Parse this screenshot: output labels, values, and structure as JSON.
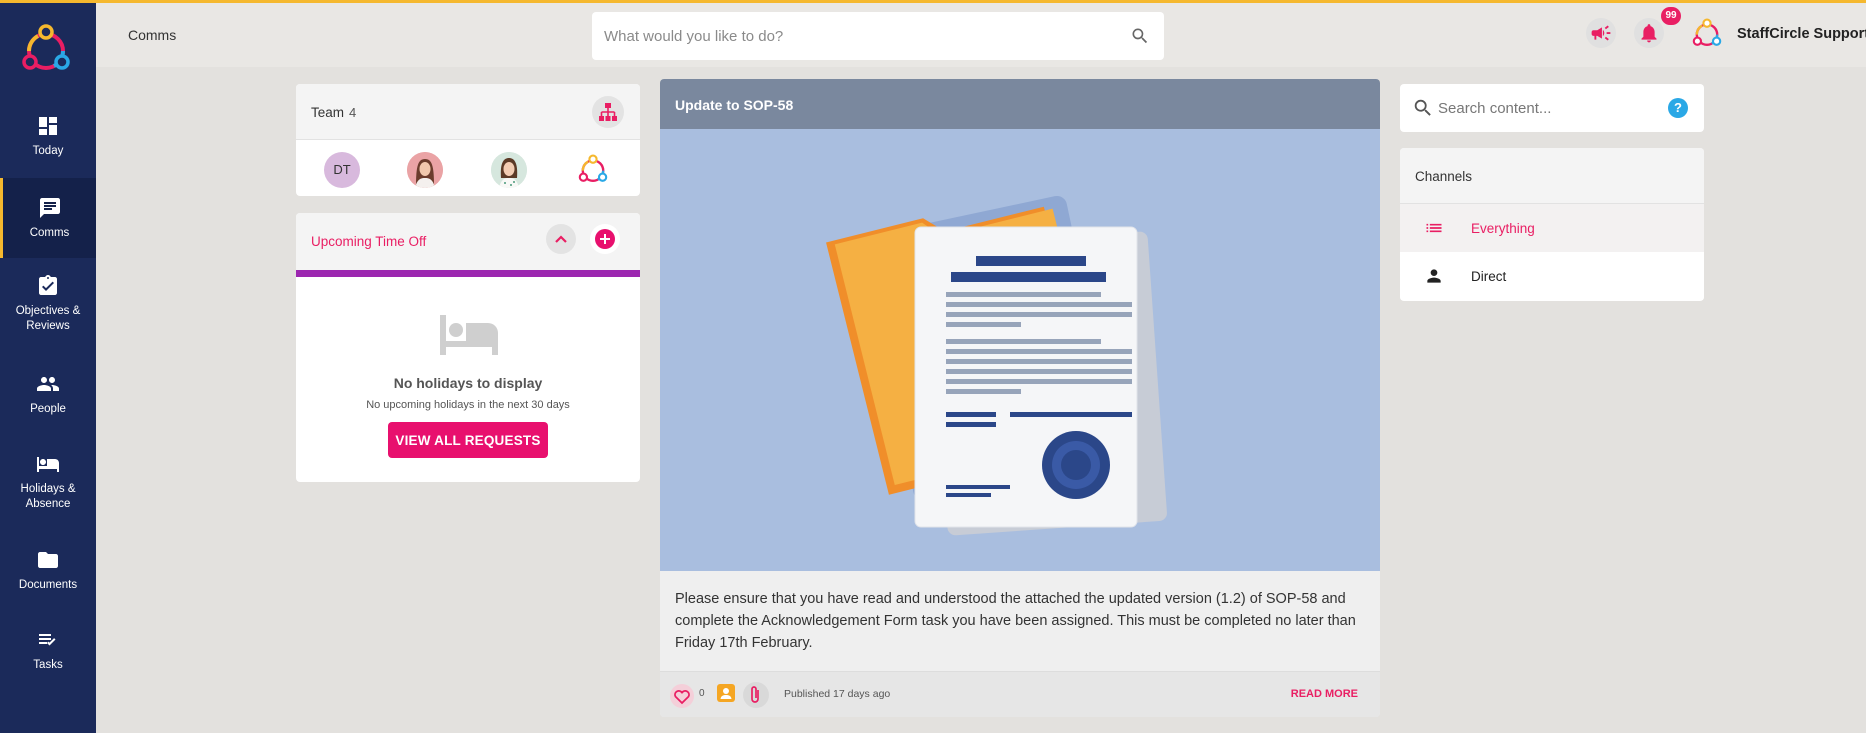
{
  "app": {
    "user_name": "StaffCircle Support",
    "notification_count": "99",
    "brand_colors": {
      "accent": "#e8106e",
      "sidebar": "#1b2a5a",
      "top_line": "#f5b82e",
      "purple": "#9c27b0"
    }
  },
  "header": {
    "breadcrumb": "Comms",
    "search_placeholder": "What would you like to do?"
  },
  "sidebar": {
    "items": [
      {
        "label": "Today",
        "icon": "dashboard-icon"
      },
      {
        "label": "Comms",
        "icon": "chat-icon",
        "active": true
      },
      {
        "label": "Objectives & Reviews",
        "icon": "clipboard-check-icon"
      },
      {
        "label": "People",
        "icon": "people-icon"
      },
      {
        "label": "Holidays & Absence",
        "icon": "bed-icon"
      },
      {
        "label": "Documents",
        "icon": "folder-icon"
      },
      {
        "label": "Tasks",
        "icon": "checklist-icon"
      }
    ]
  },
  "team": {
    "title": "Team",
    "count": "4",
    "members": [
      {
        "initials": "DT"
      }
    ]
  },
  "time_off": {
    "title": "Upcoming Time Off",
    "empty_title": "No holidays to display",
    "empty_subtitle": "No upcoming holidays in the next 30 days",
    "button_label": "VIEW ALL REQUESTS"
  },
  "post": {
    "title": "Update to SOP-58",
    "body": "Please ensure that you have read and understood the attached the updated version (1.2) of SOP-58 and complete the Acknowledgement Form task you have been assigned. This must be completed no later than Friday 17th February.",
    "like_count": "0",
    "published": "Published 17 days ago",
    "read_more": "READ MORE"
  },
  "content_search": {
    "placeholder": "Search content..."
  },
  "channels": {
    "title": "Channels",
    "items": [
      {
        "label": "Everything",
        "icon": "list-icon",
        "selected": true
      },
      {
        "label": "Direct",
        "icon": "person-icon"
      }
    ]
  }
}
